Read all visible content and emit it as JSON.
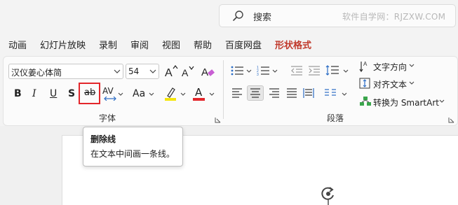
{
  "search": {
    "label": "搜索",
    "watermark": "软件自学网：RJZXW.COM"
  },
  "tabs": [
    "动画",
    "幻灯片放映",
    "录制",
    "审阅",
    "视图",
    "帮助",
    "百度网盘",
    "形状格式"
  ],
  "font": {
    "family_value": "汉仪姜心体简",
    "size_value": "54",
    "bold_label": "B",
    "italic_label": "I",
    "underline_label": "U",
    "shadow_label": "S",
    "strike_label": "ab",
    "spacing_label": "AV",
    "case_label": "Aa",
    "color_label": "A",
    "highlight_color": "#f5e60a",
    "font_color": "#e3262b",
    "group_label": "字体"
  },
  "paragraph": {
    "group_label": "段落",
    "text_direction_label": "文字方向",
    "align_text_label": "对齐文本",
    "smartart_label": "转换为 SmartArt"
  },
  "tooltip": {
    "title": "删除线",
    "description": "在文本中间画一条线。"
  },
  "colors": {
    "accent_red": "#e3262b",
    "active_tab": "#c0392b"
  }
}
